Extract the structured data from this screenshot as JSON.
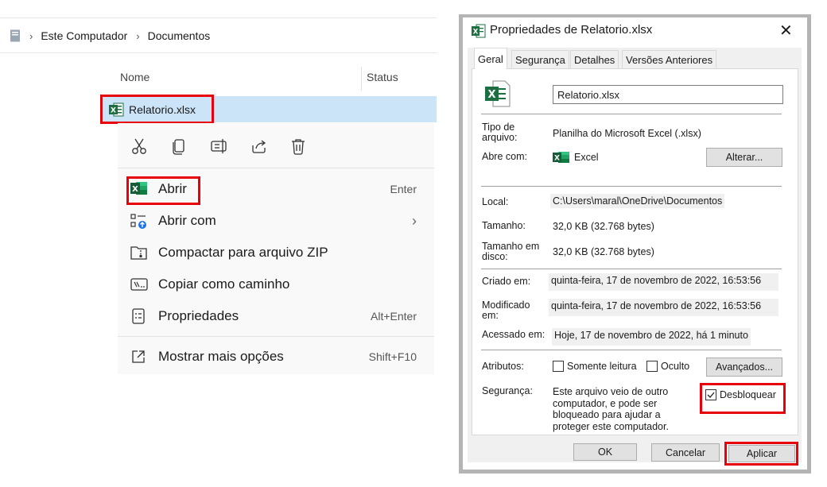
{
  "explorer": {
    "breadcrumb": [
      "Este Computador",
      "Documentos"
    ],
    "columns": {
      "name": "Nome",
      "status": "Status"
    },
    "file_name": "Relatorio.xlsx"
  },
  "context_menu": {
    "quick_actions": [
      "cut-icon",
      "copy-icon",
      "rename-icon",
      "share-icon",
      "delete-icon"
    ],
    "items": [
      {
        "label": "Abrir",
        "shortcut": "Enter",
        "icon": "excel-icon"
      },
      {
        "label": "Abrir com",
        "shortcut": "›",
        "icon": "open-with-icon"
      },
      {
        "label": "Compactar para arquivo ZIP",
        "shortcut": "",
        "icon": "zip-icon"
      },
      {
        "label": "Copiar como caminho",
        "shortcut": "",
        "icon": "copy-path-icon"
      },
      {
        "label": "Propriedades",
        "shortcut": "Alt+Enter",
        "icon": "properties-icon"
      },
      {
        "label": "Mostrar mais opções",
        "shortcut": "Shift+F10",
        "icon": "more-options-icon"
      }
    ]
  },
  "dialog": {
    "title": "Propriedades de Relatorio.xlsx",
    "close": "✕",
    "tabs": [
      "Geral",
      "Segurança",
      "Detalhes",
      "Versões Anteriores"
    ],
    "file_name_value": "Relatorio.xlsx",
    "type_label": "Tipo de arquivo:",
    "type_value": "Planilha do Microsoft Excel (.xlsx)",
    "opens_label": "Abre com:",
    "opens_value": "Excel",
    "change_button": "Alterar...",
    "location_label": "Local:",
    "location_value": "C:\\Users\\maral\\OneDrive\\Documentos",
    "size_label": "Tamanho:",
    "size_value": "32,0 KB (32.768 bytes)",
    "disk_size_label": "Tamanho em disco:",
    "disk_size_value": "32,0 KB (32.768 bytes)",
    "created_label": "Criado em:",
    "created_value": "quinta-feira, 17 de novembro de 2022, 16:53:56",
    "modified_label": "Modificado em:",
    "modified_value": "quinta-feira, 17 de novembro de 2022, 16:53:56",
    "accessed_label": "Acessado em:",
    "accessed_value": "Hoje, 17 de novembro de 2022, há 1 minuto",
    "attributes_label": "Atributos:",
    "readonly_label": "Somente leitura",
    "hidden_label": "Oculto",
    "advanced_button": "Avançados...",
    "security_label": "Segurança:",
    "security_text": "Este arquivo veio de outro computador, e pode ser bloqueado para ajudar a proteger este computador.",
    "unblock_label": "Desbloquear",
    "unblock_checked": true,
    "ok_button": "OK",
    "cancel_button": "Cancelar",
    "apply_button": "Aplicar"
  },
  "colors": {
    "highlight": "#e8000b",
    "selection": "#cce4f7",
    "excel_green": "#1d6f42"
  }
}
